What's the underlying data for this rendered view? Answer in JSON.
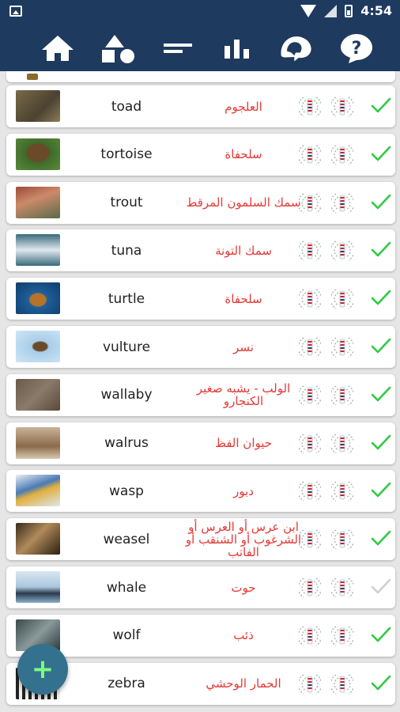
{
  "status_bar": {
    "time": "4:54"
  },
  "toolbar": {
    "icons": [
      "home-icon",
      "shapes-icon",
      "lines-icon",
      "bar-chart-icon",
      "head-speech-icon",
      "question-icon"
    ]
  },
  "colors": {
    "bar": "#1e3a5f",
    "arabic_text": "#e53935",
    "check_done": "#2ecc40",
    "check_pending": "#d0d0d0",
    "fab": "#33718f"
  },
  "entries": [
    {
      "word": "toad",
      "translation": "العلجوم",
      "learned": true,
      "image": "toad-photo"
    },
    {
      "word": "tortoise",
      "translation": "سلحفاة",
      "learned": true,
      "image": "tortoise-photo"
    },
    {
      "word": "trout",
      "translation": "سمك السلمون المرقط",
      "learned": true,
      "image": "trout-photo"
    },
    {
      "word": "tuna",
      "translation": "سمك التونة",
      "learned": true,
      "image": "tuna-photo"
    },
    {
      "word": "turtle",
      "translation": "سلحفاة",
      "learned": true,
      "image": "turtle-photo"
    },
    {
      "word": "vulture",
      "translation": "نسر",
      "learned": true,
      "image": "vulture-photo"
    },
    {
      "word": "wallaby",
      "translation": "الولب - يشبه صغير الكنجارو",
      "learned": true,
      "image": "wallaby-photo"
    },
    {
      "word": "walrus",
      "translation": "حيوان الفظ",
      "learned": true,
      "image": "walrus-photo"
    },
    {
      "word": "wasp",
      "translation": "دبور",
      "learned": true,
      "image": "wasp-photo"
    },
    {
      "word": "weasel",
      "translation": "ابن عرس أو العرس أو الشرغوب أو الشنقب أو الفاتب",
      "learned": true,
      "image": "weasel-photo"
    },
    {
      "word": "whale",
      "translation": "حوت",
      "learned": false,
      "image": "whale-photo"
    },
    {
      "word": "wolf",
      "translation": "ذئب",
      "learned": true,
      "image": "wolf-photo"
    },
    {
      "word": "zebra",
      "translation": "الحمار الوحشي",
      "learned": true,
      "image": "zebra-photo"
    }
  ],
  "fab": {
    "label": "+"
  }
}
